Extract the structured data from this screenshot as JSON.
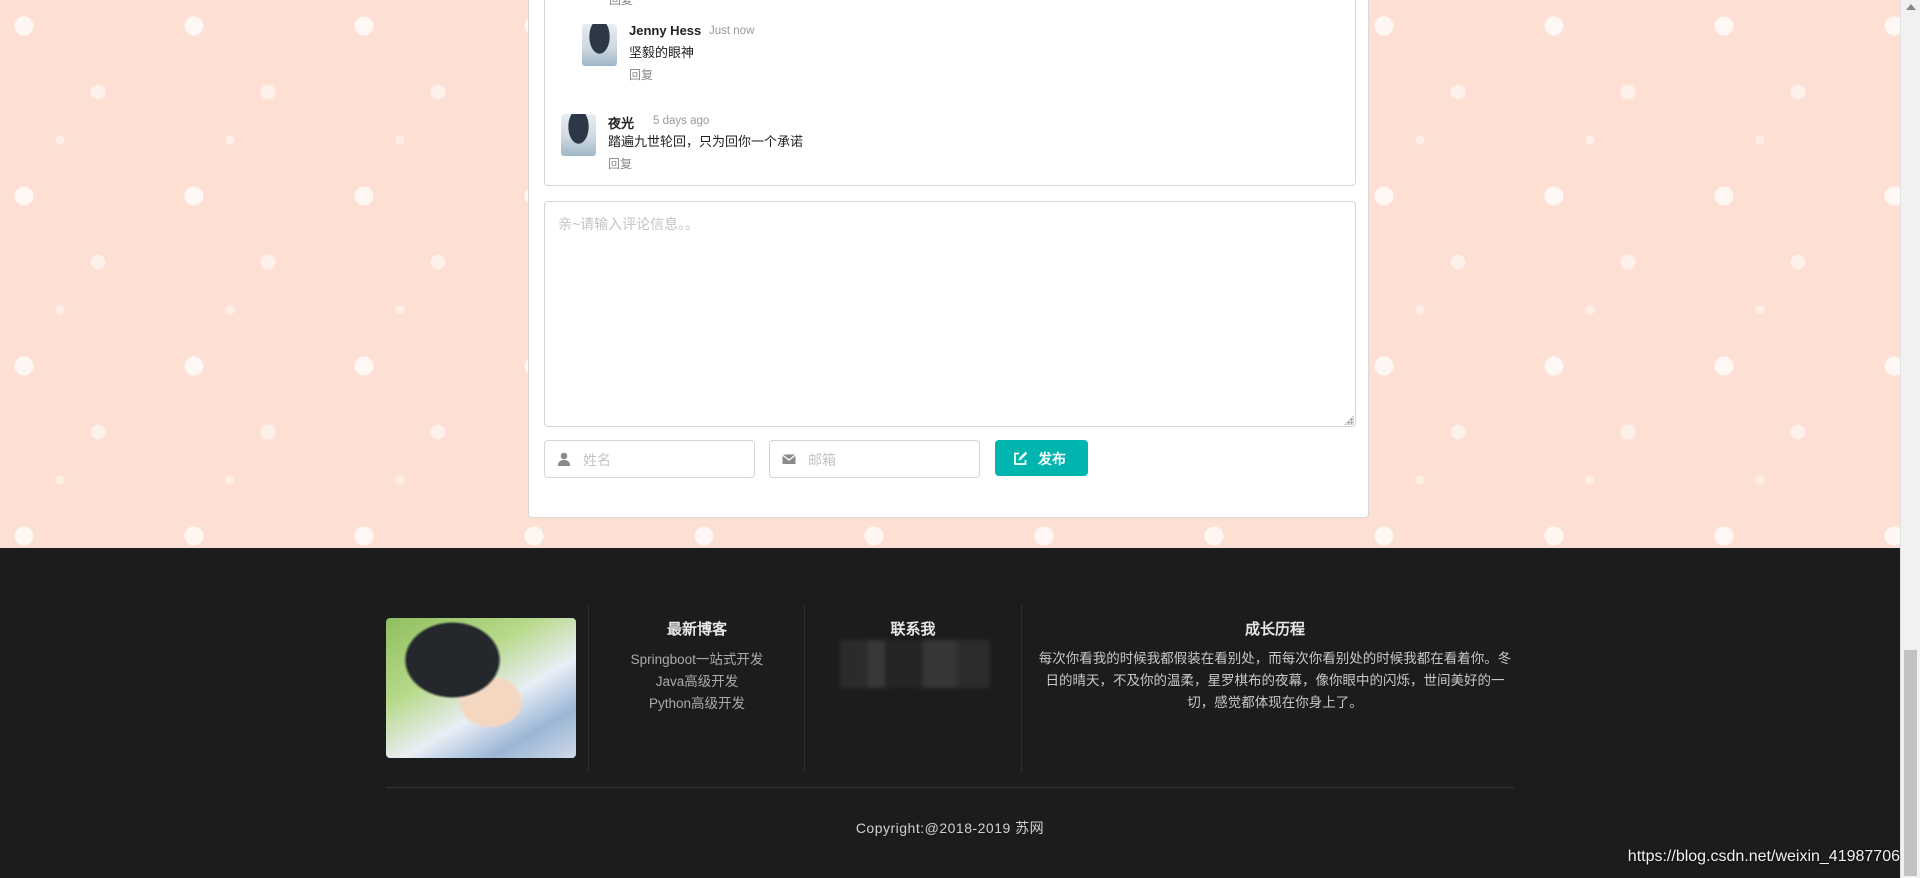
{
  "comments": {
    "top_reply_label": "回复",
    "items": [
      {
        "author": "Jenny Hess",
        "time": "Just now",
        "text": "坚毅的眼神",
        "reply_label": "回复"
      },
      {
        "author": "夜光",
        "time": "5 days ago",
        "text": "踏遍九世轮回，只为回你一个承诺",
        "reply_label": "回复"
      }
    ]
  },
  "form": {
    "comment_placeholder": "亲~请输入评论信息。。",
    "name_placeholder": "姓名",
    "email_placeholder": "邮箱",
    "publish_label": "发布",
    "name_icon": "user-icon",
    "email_icon": "envelope-icon",
    "publish_icon": "edit-icon",
    "accent_color": "#00b5ad"
  },
  "footer": {
    "latest_heading": "最新博客",
    "latest_links": [
      "Springboot一站式开发",
      "Java高级开发",
      "Python高级开发"
    ],
    "contact_heading": "联系我",
    "growth_heading": "成长历程",
    "growth_text": "每次你看我的时候我都假装在看别处，而每次你看别处的时候我都在看着你。冬日的晴天，不及你的温柔，星罗棋布的夜幕，像你眼中的闪烁，世间美好的一切，感觉都体现在你身上了。",
    "copyright": "Copyright:@2018-2019 苏网",
    "background_color": "#1b1c1d"
  },
  "watermark": "https://blog.csdn.net/weixin_41987706",
  "page_background": "#fde0d3"
}
